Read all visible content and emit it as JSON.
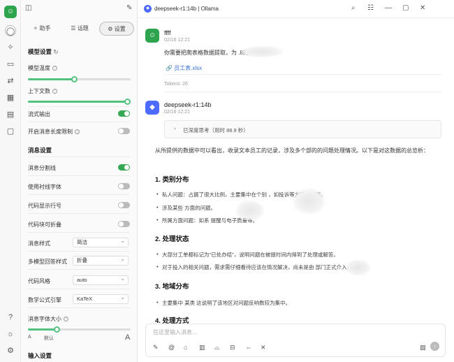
{
  "rail": {
    "avatar_text": "☺",
    "icons": [
      "message-icon",
      "sparkle-icon",
      "image-icon",
      "translate-icon",
      "apps-icon",
      "file-icon",
      "folder-icon",
      "help-icon",
      "theme-icon",
      "settings-icon"
    ]
  },
  "panel": {
    "tabs": [
      "✧ 助手",
      "☰ 话题",
      "⚙ 设置"
    ],
    "model_settings_title": "模型设置",
    "temperature_label": "模型温度",
    "context_label": "上下文数",
    "stream_label": "流式输出",
    "max_tokens_label": "开启消息长度限制",
    "message_settings_title": "消息设置",
    "divider_label": "消息分割线",
    "serif_label": "使用衬线字体",
    "code_line_label": "代码显示行号",
    "code_fold_label": "代码块可折叠",
    "msg_style_label": "消息样式",
    "msg_style_value": "简洁",
    "multi_model_label": "多模型回答样式",
    "multi_model_value": "折叠",
    "code_style_label": "代码风格",
    "code_style_value": "auto",
    "math_label": "数学公式引擎",
    "math_value": "KaTeX",
    "font_size_label": "消息字体大小",
    "font_small": "A",
    "font_default": "默认",
    "font_large": "A",
    "input_settings_title": "输入设置",
    "temperature_value": 0.45,
    "context_value": 1.0,
    "font_size_value": 0.28,
    "stream_on": true,
    "max_tokens_on": false,
    "divider_on": true,
    "serif_on": false,
    "code_line_on": false,
    "code_fold_on": false
  },
  "header": {
    "title": "deepseek-r1:14b | Ollama"
  },
  "user_msg": {
    "name": "ffff",
    "time": "02/16 12:21",
    "text": "你需要把爬表格数据提取，为                  .8的相关目录",
    "attachment": "员工表.xlsx",
    "tokens": "Tokens: 26"
  },
  "bot_msg": {
    "name": "deepseek-r1:14b",
    "time": "02/16 12:21",
    "think_label": "已深度思考（用时 88.9 秒）",
    "intro": "从所提供的数据中可以看出，收录文本员工的记录，涉及多个部的的问题处理情况。以下是对这数据的总览析：",
    "sections": [
      {
        "title": "1. 类别分布",
        "bullets": [
          "私人问题：占据了很大比例，主要集中在个别            ，如投诉等方面的问题。",
          "          涉及某些         方面的问题。",
          "所属方面问题：如系          提醒与电子质量等。"
        ]
      },
      {
        "title": "2. 处理状态",
        "bullets": [
          "大部分工单都标记为\"已处办结\"，说明问题在被提时间内得到了处理或解答。",
          "对于投入的相关问题，需求需仔细看待应该在情况解决，尚未是由           部门正式介入。"
        ]
      },
      {
        "title": "3. 地域分布",
        "bullets": [
          "主要集中            某类         这说明了该地区对问题反响数较为集中。"
        ]
      },
      {
        "title": "4. 处理方式",
        "bullets": []
      }
    ]
  },
  "input": {
    "placeholder": "在这里输入消息..."
  }
}
